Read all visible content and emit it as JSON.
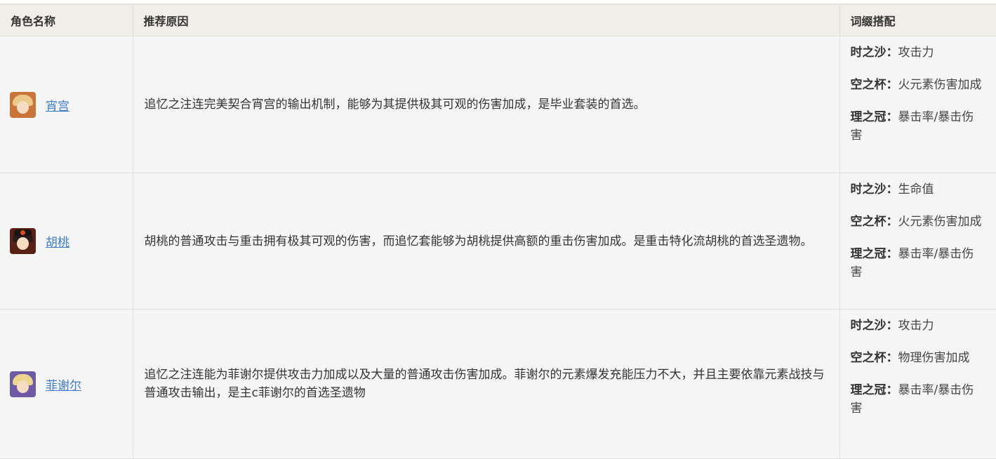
{
  "table": {
    "headers": [
      "角色名称",
      "推荐原因",
      "词缀搭配"
    ],
    "rows": [
      {
        "name": "宵宫",
        "reason": "追忆之注连完美契合宵宫的输出机制，能够为其提供极其可观的伤害加成，是毕业套装的首选。",
        "affixes": [
          {
            "key": "时之沙：",
            "value": "攻击力"
          },
          {
            "key": "空之杯：",
            "value": "火元素伤害加成"
          },
          {
            "key": "理之冠：",
            "value": "暴击率/暴击伤害"
          }
        ]
      },
      {
        "name": "胡桃",
        "reason": "胡桃的普通攻击与重击拥有极其可观的伤害，而追忆套能够为胡桃提供高额的重击伤害加成。是重击特化流胡桃的首选圣遗物。",
        "affixes": [
          {
            "key": "时之沙：",
            "value": "生命值"
          },
          {
            "key": "空之杯：",
            "value": "火元素伤害加成"
          },
          {
            "key": "理之冠：",
            "value": "暴击率/暴击伤害"
          }
        ]
      },
      {
        "name": "菲谢尔",
        "reason": "追忆之注连能为菲谢尔提供攻击力加成以及大量的普通攻击伤害加成。菲谢尔的元素爆发充能压力不大，并且主要依靠元素战技与普通攻击输出，是主c菲谢尔的首选圣遗物",
        "affixes": [
          {
            "key": "时之沙：",
            "value": "攻击力"
          },
          {
            "key": "空之杯：",
            "value": "物理伤害加成"
          },
          {
            "key": "理之冠：",
            "value": "暴击率/暴击伤害"
          }
        ]
      }
    ]
  }
}
